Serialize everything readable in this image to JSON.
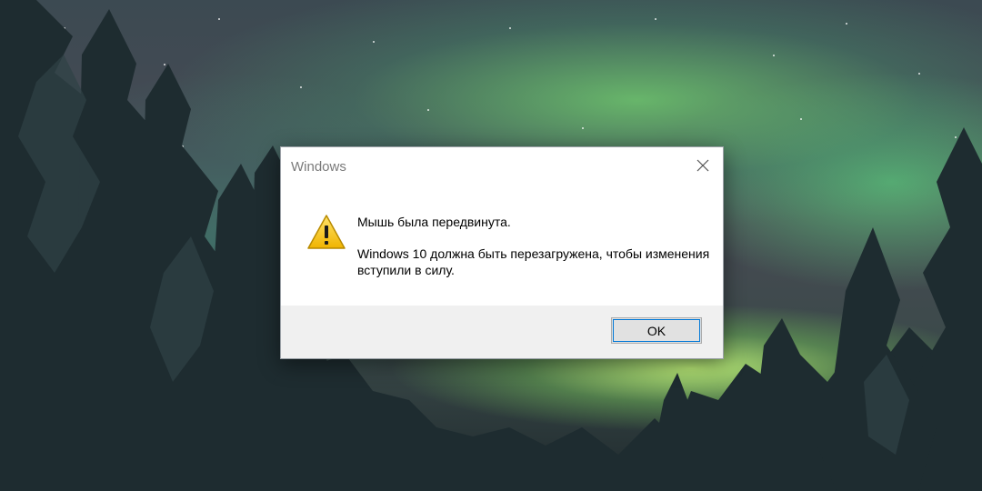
{
  "dialog": {
    "title": "Windows",
    "message_line1": "Мышь была передвинута.",
    "message_line2": "Windows 10 должна быть перезагружена, чтобы изменения вступили в силу.",
    "ok_label": "OK",
    "icon": "warning-icon",
    "close_icon": "close-icon"
  },
  "colors": {
    "dialog_bg": "#ffffff",
    "footer_bg": "#f0f0f0",
    "title_text": "#7a7a7a",
    "button_bg": "#e1e1e1",
    "button_focus": "#0078d7",
    "warning_yellow": "#f5c400"
  }
}
